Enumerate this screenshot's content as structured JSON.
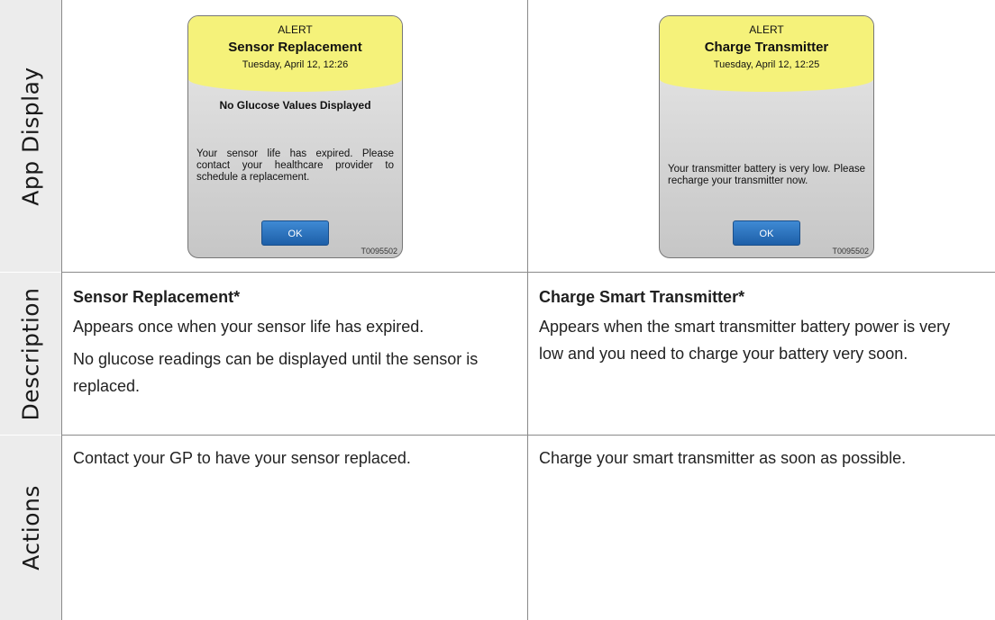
{
  "rows": {
    "app_display": "App Display",
    "description": "Description",
    "actions": "Actions"
  },
  "left": {
    "alert": {
      "kicker": "ALERT",
      "title": "Sensor Replacement",
      "date": "Tuesday, April 12, 12:26",
      "subtitle": "No Glucose Values Displayed",
      "body": "Your sensor life has expired. Please contact your healthcare provider to schedule a replacement.",
      "button": "OK",
      "code": "T0095502"
    },
    "description": {
      "title": "Sensor Replacement*",
      "para1": "Appears once when your sensor life has expired.",
      "para2": "No glucose readings can be displayed until the sensor is replaced."
    },
    "action": "Contact your GP to have your sensor replaced."
  },
  "right": {
    "alert": {
      "kicker": "ALERT",
      "title": "Charge Transmitter",
      "date": "Tuesday, April 12, 12:25",
      "body": "Your transmitter battery is very low. Please recharge your transmitter now.",
      "button": "OK",
      "code": "T0095502"
    },
    "description": {
      "title": "Charge Smart Transmitter*",
      "para1": "Appears when the smart transmitter battery power is very low and you need to charge your battery very soon."
    },
    "action": "Charge your smart transmitter as soon as possible."
  }
}
